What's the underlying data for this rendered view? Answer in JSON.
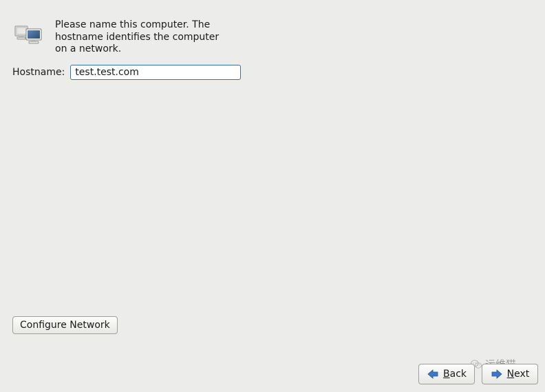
{
  "header": {
    "description": "Please name this computer.  The hostname identifies the computer on a network."
  },
  "hostname": {
    "label": "Hostname:",
    "value": "test.test.com"
  },
  "buttons": {
    "configure_network": "Configure Network",
    "back_prefix": "B",
    "back_rest": "ack",
    "next_prefix": "N",
    "next_rest": "ext"
  },
  "watermark": {
    "text": "运维猫"
  },
  "icons": {
    "header": "computer-network-icon",
    "back": "arrow-left-icon",
    "next": "arrow-right-icon",
    "watermark": "wechat-icon"
  }
}
